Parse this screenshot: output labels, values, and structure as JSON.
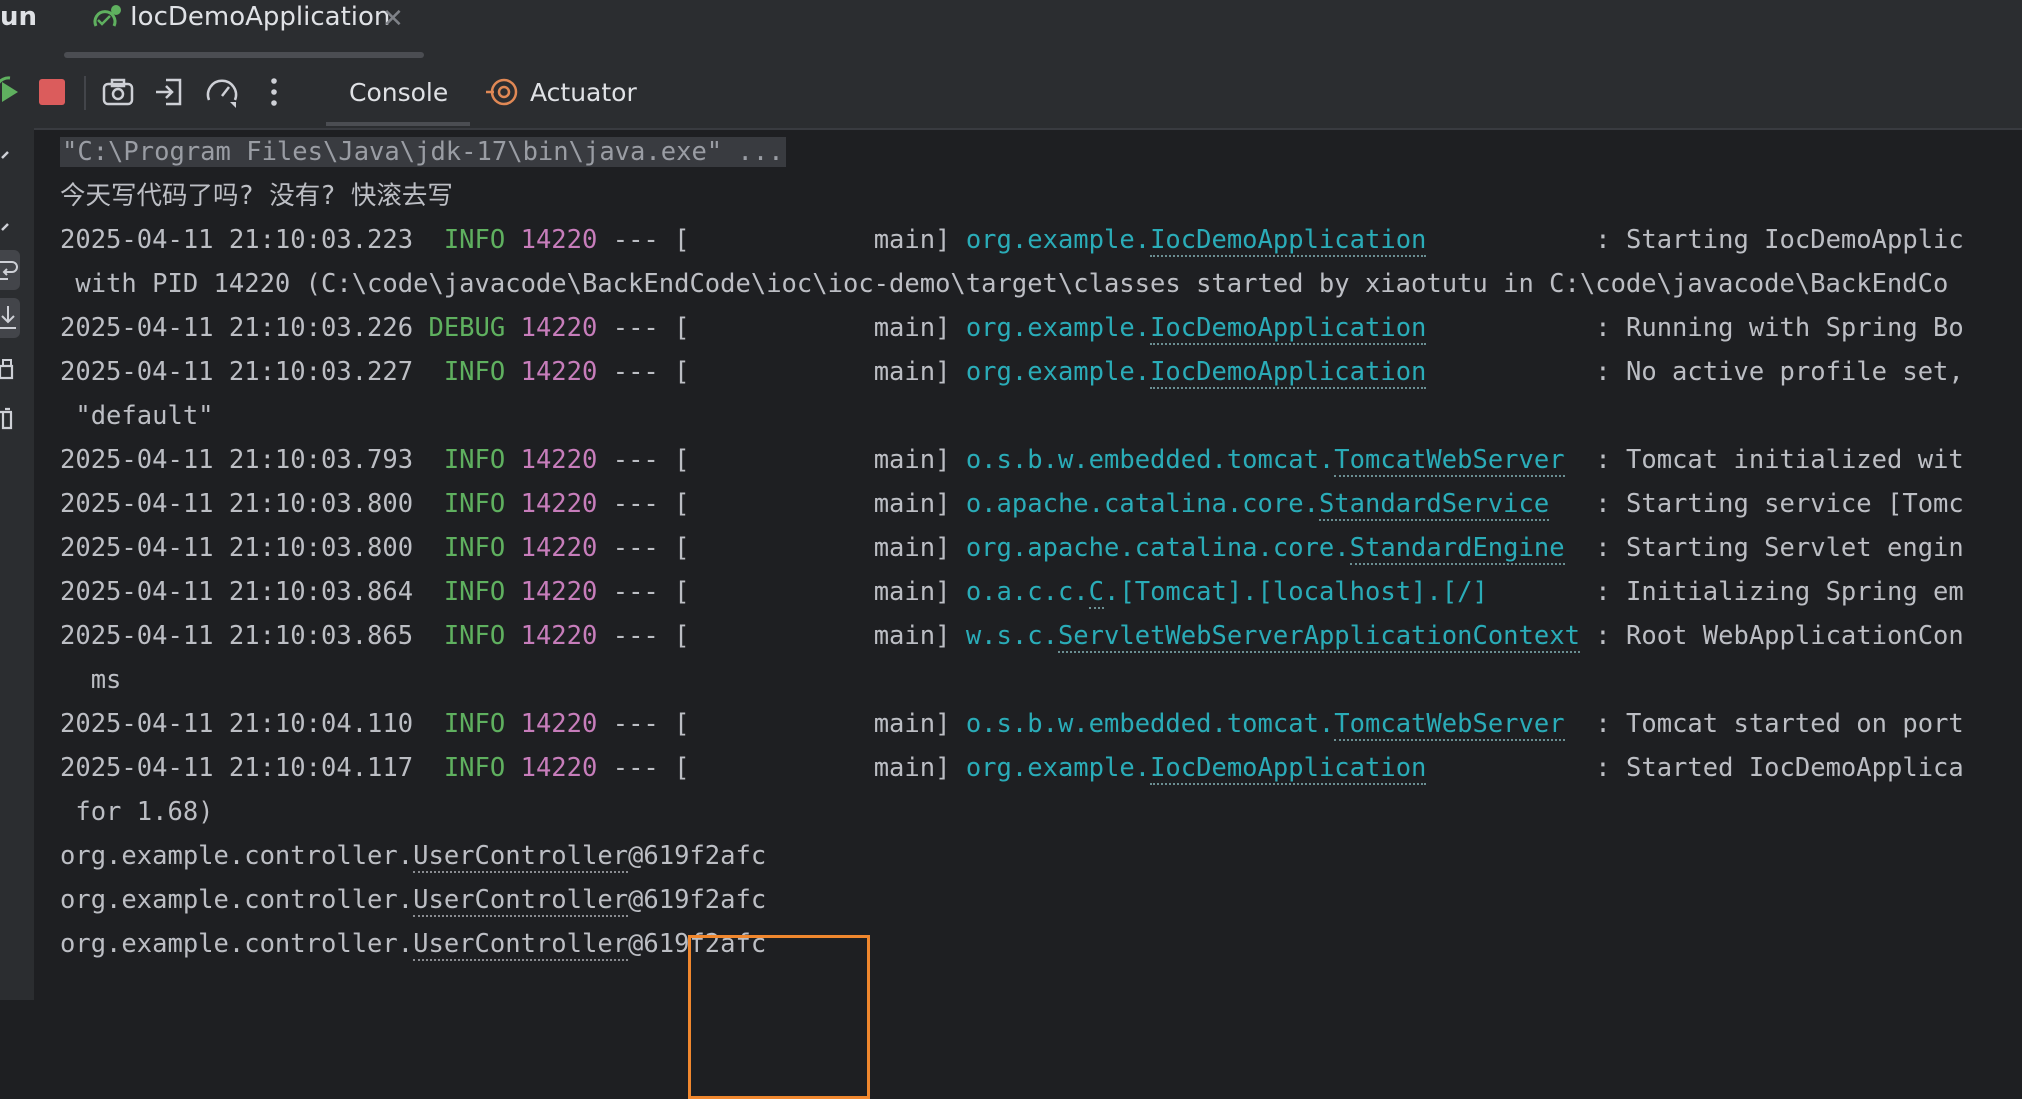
{
  "tabbar": {
    "run_label": "un",
    "tab_title": "IocDemoApplication",
    "close": "✕"
  },
  "toolbar": {
    "tabs": [
      {
        "label": "Console"
      },
      {
        "label": "Actuator"
      }
    ]
  },
  "console": {
    "command": "\"C:\\Program Files\\Java\\jdk-17\\bin\\java.exe\" ...",
    "banner": "今天写代码了吗? 没有? 快滚去写",
    "logs": [
      {
        "ts": "2025-04-11 21:10:03.223",
        "level": " INFO",
        "pid": "14220",
        "sep": " --- [            main] ",
        "pkg": "org.example.",
        "cls": "IocDemoApplication",
        "pad": "           ",
        "msg": ": Starting IocDemoApplic"
      },
      {
        "cont": " with PID 14220 (C:\\code\\javacode\\BackEndCode\\ioc\\ioc-demo\\target\\classes started by xiaotutu in C:\\code\\javacode\\BackEndCo"
      },
      {
        "ts": "2025-04-11 21:10:03.226",
        "level": "DEBUG",
        "pid": "14220",
        "sep": " --- [            main] ",
        "pkg": "org.example.",
        "cls": "IocDemoApplication",
        "pad": "           ",
        "msg": ": Running with Spring Bo"
      },
      {
        "ts": "2025-04-11 21:10:03.227",
        "level": " INFO",
        "pid": "14220",
        "sep": " --- [            main] ",
        "pkg": "org.example.",
        "cls": "IocDemoApplication",
        "pad": "           ",
        "msg": ": No active profile set,"
      },
      {
        "cont": " \"default\""
      },
      {
        "ts": "2025-04-11 21:10:03.793",
        "level": " INFO",
        "pid": "14220",
        "sep": " --- [            main] ",
        "pkg": "o.s.b.w.embedded.tomcat.",
        "cls": "TomcatWebServer",
        "pad": "  ",
        "msg": ": Tomcat initialized wit"
      },
      {
        "ts": "2025-04-11 21:10:03.800",
        "level": " INFO",
        "pid": "14220",
        "sep": " --- [            main] ",
        "pkg": "o.apache.catalina.core.",
        "cls": "StandardService",
        "pad": "   ",
        "msg": ": Starting service [Tomc"
      },
      {
        "ts": "2025-04-11 21:10:03.800",
        "level": " INFO",
        "pid": "14220",
        "sep": " --- [            main] ",
        "pkg": "org.apache.catalina.core.",
        "cls": "StandardEngine",
        "pad": "  ",
        "msg": ": Starting Servlet engin"
      },
      {
        "ts": "2025-04-11 21:10:03.864",
        "level": " INFO",
        "pid": "14220",
        "sep": " --- [            main] ",
        "pkg": "o.a.c.c.",
        "cls": "C",
        "pkg2": ".[Tomcat].[localhost].[/]",
        "pad": "       ",
        "msg": ": Initializing Spring em"
      },
      {
        "ts": "2025-04-11 21:10:03.865",
        "level": " INFO",
        "pid": "14220",
        "sep": " --- [            main] ",
        "pkg": "w.s.c.",
        "cls": "ServletWebServerApplicationContext",
        "pad": " ",
        "msg": ": Root WebApplicationCon"
      },
      {
        "cont": "  ms"
      },
      {
        "ts": "2025-04-11 21:10:04.110",
        "level": " INFO",
        "pid": "14220",
        "sep": " --- [            main] ",
        "pkg": "o.s.b.w.embedded.tomcat.",
        "cls": "TomcatWebServer",
        "pad": "  ",
        "msg": ": Tomcat started on port"
      },
      {
        "ts": "2025-04-11 21:10:04.117",
        "level": " INFO",
        "pid": "14220",
        "sep": " --- [            main] ",
        "pkg": "org.example.",
        "cls": "IocDemoApplication",
        "pad": "           ",
        "msg": ": Started IocDemoApplica"
      },
      {
        "cont": " for 1.68)"
      }
    ],
    "outputs": [
      {
        "pkg": "org.example.controller.",
        "cls": "UserController",
        "hash": "@619f2afc"
      },
      {
        "pkg": "org.example.controller.",
        "cls": "UserController",
        "hash": "@619f2afc"
      },
      {
        "pkg": "org.example.controller.",
        "cls": "UserController",
        "hash": "@619f2afc"
      }
    ]
  },
  "colors": {
    "background": "#1e1f22",
    "toolbar": "#2b2d30",
    "level": "#5fb05f",
    "pid": "#c77dbb",
    "logger": "#2aacb8",
    "highlight": "#f0872e"
  }
}
